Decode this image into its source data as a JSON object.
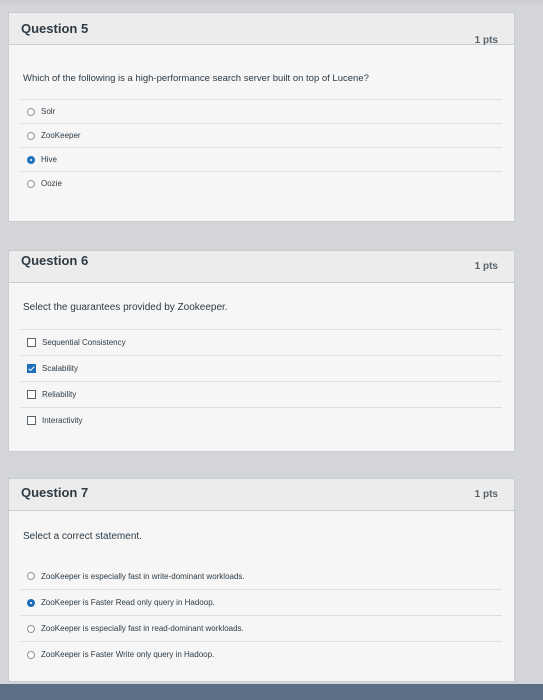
{
  "questions": [
    {
      "title": "Question 5",
      "points": "1 pts",
      "text": "Which of the following is a high-performance search server built on top of Lucene?",
      "answers": [
        {
          "label": "Solr",
          "selected": false
        },
        {
          "label": "ZooKeeper",
          "selected": false
        },
        {
          "label": "Hive",
          "selected": true
        },
        {
          "label": "Oozie",
          "selected": false
        }
      ]
    },
    {
      "title": "Question 6",
      "points": "1 pts",
      "text": "Select the guarantees provided by Zookeeper.",
      "answers": [
        {
          "label": "Sequential Consistency",
          "checked": false
        },
        {
          "label": "Scalability",
          "checked": true
        },
        {
          "label": "Reliability",
          "checked": false
        },
        {
          "label": "Interactivity",
          "checked": false
        }
      ]
    },
    {
      "title": "Question 7",
      "points": "1 pts",
      "text": "Select a correct statement.",
      "answers": [
        {
          "label": "ZooKeeper is especially fast in write-dominant workloads.",
          "selected": false
        },
        {
          "label": "ZooKeeper is Faster Read only query in Hadoop.",
          "selected": true
        },
        {
          "label": "ZooKeeper is especially fast in read-dominant workloads.",
          "selected": false
        },
        {
          "label": "ZooKeeper is Faster Write only query in Hadoop.",
          "selected": false
        }
      ]
    }
  ],
  "colors": {
    "accent": "#1c6fb8",
    "header_bg": "#ececec",
    "card_bg": "#f6f6f7",
    "page_bg": "#d4d5d8"
  }
}
